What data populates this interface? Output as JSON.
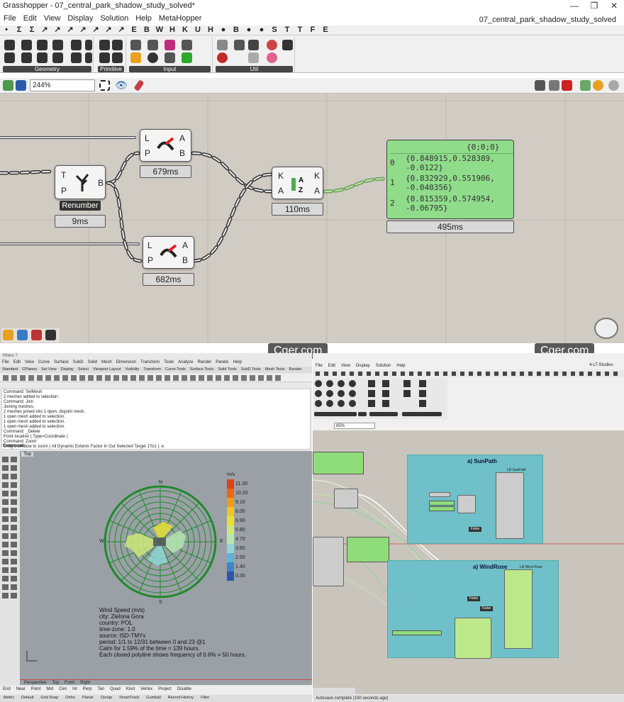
{
  "window": {
    "title": "Grasshopper - 07_central_park_shadow_study_solved*",
    "doc_name": "07_central_park_shadow_study_solved"
  },
  "menu": [
    "File",
    "Edit",
    "View",
    "Display",
    "Solution",
    "Help",
    "MetaHopper"
  ],
  "tabs": [
    "•",
    "Σ",
    "Σ",
    "↗",
    "↗",
    "↗",
    "↗",
    "↗",
    "↗",
    "↗",
    "E",
    "B",
    "W",
    "H",
    "K",
    "U",
    "H",
    "●",
    "B",
    "●",
    "●",
    "S",
    "T",
    "T",
    "F",
    "E"
  ],
  "ribbon_groups": [
    {
      "label": "Geometry"
    },
    {
      "label": "Primitive"
    },
    {
      "label": "Input"
    },
    {
      "label": "Util"
    }
  ],
  "zoom": "244%",
  "nodes": {
    "renumber": {
      "pin_in1": "T",
      "pin_in2": "P",
      "pin_out": "B",
      "name": "Renumber",
      "time": "9ms"
    },
    "top": {
      "pin_in1": "L",
      "pin_in2": "P",
      "pin_out1": "A",
      "pin_out2": "B",
      "time": "679ms"
    },
    "bottom": {
      "pin_in1": "L",
      "pin_in2": "P",
      "pin_out1": "A",
      "pin_out2": "B",
      "time": "682ms"
    },
    "sort": {
      "pin_in1": "K",
      "pin_in2": "A",
      "pin_out1": "K",
      "pin_out2": "A",
      "time": "110ms"
    },
    "panel": {
      "header": "{0;0;0}",
      "rows": [
        {
          "index": "0",
          "line1": "{0.848915,0.528389,",
          "line2": "-0.0122}"
        },
        {
          "index": "1",
          "line1": "{0.832929,0.551906,",
          "line2": "-0.040356}"
        },
        {
          "index": "2",
          "line1": "{0.815359,0.574954,",
          "line2": "-0.06795}"
        }
      ],
      "time": "495ms"
    }
  },
  "watermarks": [
    "Cger.com",
    "Cger.com"
  ],
  "rhino": {
    "title": "Rhino 7",
    "menu": [
      "File",
      "Edit",
      "View",
      "Curve",
      "Surface",
      "SubD",
      "Solid",
      "Mesh",
      "Dimension",
      "Transform",
      "Tools",
      "Analyze",
      "Render",
      "Panels",
      "Help"
    ],
    "tabs": [
      "Standard",
      "CPlanes",
      "Set View",
      "Display",
      "Select",
      "Viewport Layout",
      "Visibility",
      "Transform",
      "Curve Tools",
      "Surface Tools",
      "Solid Tools",
      "SubD Tools",
      "Mesh Tools",
      "Render"
    ],
    "command_history": [
      "Command: SelMesh",
      "2 meshes added to selection.",
      "Command: Join",
      "Joining meshes.",
      "2 meshes joined into 1 open, disjoint mesh.",
      "1 open mesh added to selection.",
      "1 open mesh added to selection.",
      "1 open mesh added to selection.",
      "Command: _Delete",
      "Point location ( Type=Coordinate )",
      "Command: Zoom",
      "Drag a window to zoom ( All  Dynamic  Extents  Factor  In  Out  Selected  Target  1To1 ): e"
    ],
    "command_prompt": "Command:",
    "viewport_label": "Top",
    "legend_unit": "m/s",
    "legend": [
      {
        "value": "11.30",
        "color": "#e0401a"
      },
      {
        "value": "10.20",
        "color": "#e86a18"
      },
      {
        "value": "9.10",
        "color": "#f09a1e"
      },
      {
        "value": "8.00",
        "color": "#f2c420"
      },
      {
        "value": "6.90",
        "color": "#e9df35"
      },
      {
        "value": "5.80",
        "color": "#cde87a"
      },
      {
        "value": "4.70",
        "color": "#b6e6b0"
      },
      {
        "value": "3.60",
        "color": "#8fd6d6"
      },
      {
        "value": "2.50",
        "color": "#5fb3d8"
      },
      {
        "value": "1.40",
        "color": "#3d85c8"
      },
      {
        "value": "0.30",
        "color": "#2d56a8"
      }
    ],
    "compass": {
      "n": "N",
      "e": "E",
      "s": "S",
      "w": "W"
    },
    "caption": [
      "Wind Speed (m/s)",
      "city: Zielona Gora",
      "country: POL",
      "time-zone: 1.0",
      "source: ISD-TMYx",
      "period: 1/1 to 12/31 between 0 and 23 @1",
      "Calm for 1.59% of the time = 139 hours.",
      "Each closed polyline shows frequency of 0.6% = 50 hours."
    ],
    "view_tabs": [
      "Perspective",
      "Top",
      "Front",
      "Right"
    ],
    "osnaps": [
      "End",
      "Near",
      "Point",
      "Mid",
      "Cen",
      "Int",
      "Perp",
      "Tan",
      "Quad",
      "Knot",
      "Vertex",
      "Project",
      "Disable"
    ],
    "status": [
      "Metric",
      "Default",
      "Grid Snap",
      "Ortho",
      "Planar",
      "Osnap",
      "SmartTrack",
      "Gumball",
      "Record History",
      "Filter"
    ]
  },
  "gh2": {
    "menu": [
      "File",
      "Edit",
      "View",
      "Display",
      "Solution",
      "Help"
    ],
    "doc": "4-LT-Studies",
    "zoom": "85%",
    "sunpath": {
      "title": "a) SunPath",
      "header": "LB SunPath"
    },
    "windrose": {
      "title": "a) WindRose",
      "header": "LB Wind Rose"
    },
    "toggles": [
      "False",
      "False",
      "False"
    ],
    "status": "Autosave complete (130 seconds ago)"
  }
}
